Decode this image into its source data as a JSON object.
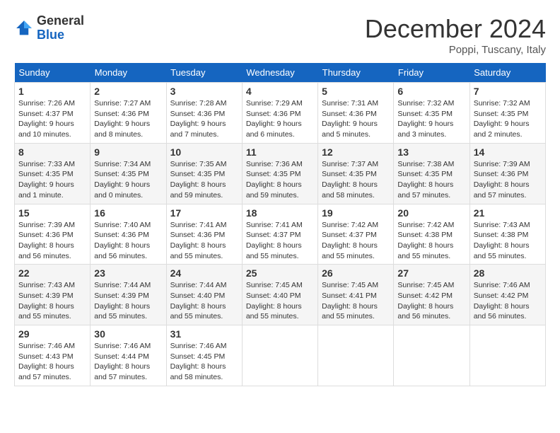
{
  "header": {
    "logo_general": "General",
    "logo_blue": "Blue",
    "month_title": "December 2024",
    "location": "Poppi, Tuscany, Italy"
  },
  "calendar": {
    "days_of_week": [
      "Sunday",
      "Monday",
      "Tuesday",
      "Wednesday",
      "Thursday",
      "Friday",
      "Saturday"
    ],
    "weeks": [
      [
        {
          "day": "1",
          "sunrise": "7:26 AM",
          "sunset": "4:37 PM",
          "daylight": "9 hours and 10 minutes."
        },
        {
          "day": "2",
          "sunrise": "7:27 AM",
          "sunset": "4:36 PM",
          "daylight": "9 hours and 8 minutes."
        },
        {
          "day": "3",
          "sunrise": "7:28 AM",
          "sunset": "4:36 PM",
          "daylight": "9 hours and 7 minutes."
        },
        {
          "day": "4",
          "sunrise": "7:29 AM",
          "sunset": "4:36 PM",
          "daylight": "9 hours and 6 minutes."
        },
        {
          "day": "5",
          "sunrise": "7:31 AM",
          "sunset": "4:36 PM",
          "daylight": "9 hours and 5 minutes."
        },
        {
          "day": "6",
          "sunrise": "7:32 AM",
          "sunset": "4:35 PM",
          "daylight": "9 hours and 3 minutes."
        },
        {
          "day": "7",
          "sunrise": "7:32 AM",
          "sunset": "4:35 PM",
          "daylight": "9 hours and 2 minutes."
        }
      ],
      [
        {
          "day": "8",
          "sunrise": "7:33 AM",
          "sunset": "4:35 PM",
          "daylight": "9 hours and 1 minute."
        },
        {
          "day": "9",
          "sunrise": "7:34 AM",
          "sunset": "4:35 PM",
          "daylight": "9 hours and 0 minutes."
        },
        {
          "day": "10",
          "sunrise": "7:35 AM",
          "sunset": "4:35 PM",
          "daylight": "8 hours and 59 minutes."
        },
        {
          "day": "11",
          "sunrise": "7:36 AM",
          "sunset": "4:35 PM",
          "daylight": "8 hours and 59 minutes."
        },
        {
          "day": "12",
          "sunrise": "7:37 AM",
          "sunset": "4:35 PM",
          "daylight": "8 hours and 58 minutes."
        },
        {
          "day": "13",
          "sunrise": "7:38 AM",
          "sunset": "4:35 PM",
          "daylight": "8 hours and 57 minutes."
        },
        {
          "day": "14",
          "sunrise": "7:39 AM",
          "sunset": "4:36 PM",
          "daylight": "8 hours and 57 minutes."
        }
      ],
      [
        {
          "day": "15",
          "sunrise": "7:39 AM",
          "sunset": "4:36 PM",
          "daylight": "8 hours and 56 minutes."
        },
        {
          "day": "16",
          "sunrise": "7:40 AM",
          "sunset": "4:36 PM",
          "daylight": "8 hours and 56 minutes."
        },
        {
          "day": "17",
          "sunrise": "7:41 AM",
          "sunset": "4:36 PM",
          "daylight": "8 hours and 55 minutes."
        },
        {
          "day": "18",
          "sunrise": "7:41 AM",
          "sunset": "4:37 PM",
          "daylight": "8 hours and 55 minutes."
        },
        {
          "day": "19",
          "sunrise": "7:42 AM",
          "sunset": "4:37 PM",
          "daylight": "8 hours and 55 minutes."
        },
        {
          "day": "20",
          "sunrise": "7:42 AM",
          "sunset": "4:38 PM",
          "daylight": "8 hours and 55 minutes."
        },
        {
          "day": "21",
          "sunrise": "7:43 AM",
          "sunset": "4:38 PM",
          "daylight": "8 hours and 55 minutes."
        }
      ],
      [
        {
          "day": "22",
          "sunrise": "7:43 AM",
          "sunset": "4:39 PM",
          "daylight": "8 hours and 55 minutes."
        },
        {
          "day": "23",
          "sunrise": "7:44 AM",
          "sunset": "4:39 PM",
          "daylight": "8 hours and 55 minutes."
        },
        {
          "day": "24",
          "sunrise": "7:44 AM",
          "sunset": "4:40 PM",
          "daylight": "8 hours and 55 minutes."
        },
        {
          "day": "25",
          "sunrise": "7:45 AM",
          "sunset": "4:40 PM",
          "daylight": "8 hours and 55 minutes."
        },
        {
          "day": "26",
          "sunrise": "7:45 AM",
          "sunset": "4:41 PM",
          "daylight": "8 hours and 55 minutes."
        },
        {
          "day": "27",
          "sunrise": "7:45 AM",
          "sunset": "4:42 PM",
          "daylight": "8 hours and 56 minutes."
        },
        {
          "day": "28",
          "sunrise": "7:46 AM",
          "sunset": "4:42 PM",
          "daylight": "8 hours and 56 minutes."
        }
      ],
      [
        {
          "day": "29",
          "sunrise": "7:46 AM",
          "sunset": "4:43 PM",
          "daylight": "8 hours and 57 minutes."
        },
        {
          "day": "30",
          "sunrise": "7:46 AM",
          "sunset": "4:44 PM",
          "daylight": "8 hours and 57 minutes."
        },
        {
          "day": "31",
          "sunrise": "7:46 AM",
          "sunset": "4:45 PM",
          "daylight": "8 hours and 58 minutes."
        },
        null,
        null,
        null,
        null
      ]
    ]
  },
  "labels": {
    "sunrise_prefix": "Sunrise: ",
    "sunset_prefix": "Sunset: ",
    "daylight_prefix": "Daylight: "
  }
}
